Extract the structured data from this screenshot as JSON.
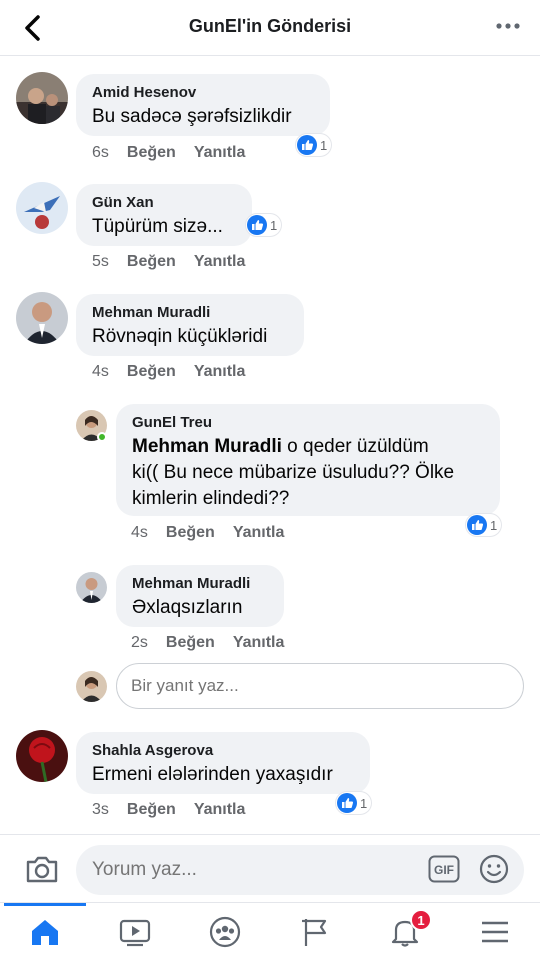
{
  "header": {
    "title": "GunEl'in Gönderisi"
  },
  "comments": [
    {
      "author": "Amid Hesenov",
      "text": "Bu sadəcə şərəfsizlikdir",
      "time": "6s",
      "like": "Beğen",
      "reply": "Yanıtla",
      "reactions": "1"
    },
    {
      "author": "Gün Xan",
      "text": "Tüpürüm sizə...",
      "time": "5s",
      "like": "Beğen",
      "reply": "Yanıtla",
      "reactions": "1"
    },
    {
      "author": "Mehman Muradli",
      "text": "Rövnəqin küçükləridi",
      "time": "4s",
      "like": "Beğen",
      "reply": "Yanıtla"
    }
  ],
  "replies": [
    {
      "author": "GunEl Treu",
      "mention": "Mehman Muradli",
      "text_line1": " o qeder üzüldüm",
      "text_line2": "ki(( Bu nece mübarize üsuludu?? Ölke",
      "text_line3": "kimlerin elindedi??",
      "time": "4s",
      "like": "Beğen",
      "reply": "Yanıtla",
      "reactions": "1"
    },
    {
      "author": "Mehman Muradli",
      "text": "Əxlaqsızların",
      "time": "2s",
      "like": "Beğen",
      "reply": "Yanıtla"
    }
  ],
  "reply_box": {
    "placeholder": "Bir yanıt yaz..."
  },
  "last_comment": {
    "author": "Shahla Asgerova",
    "text": "Ermeni elələrinden yaxaşıdır",
    "time": "3s",
    "like": "Beğen",
    "reply": "Yanıtla",
    "reactions": "1"
  },
  "composer": {
    "placeholder": "Yorum yaz...",
    "gif_label": "GIF"
  },
  "tabbar": {
    "items": [
      "home-icon",
      "video-icon",
      "groups-icon",
      "pages-flag-icon",
      "notifications-bell-icon",
      "menu-icon"
    ],
    "notification_count": "1"
  },
  "colors": {
    "accent": "#1877f2",
    "bubble": "#f0f2f5",
    "meta": "#65676b",
    "badge": "#e41e3f"
  }
}
